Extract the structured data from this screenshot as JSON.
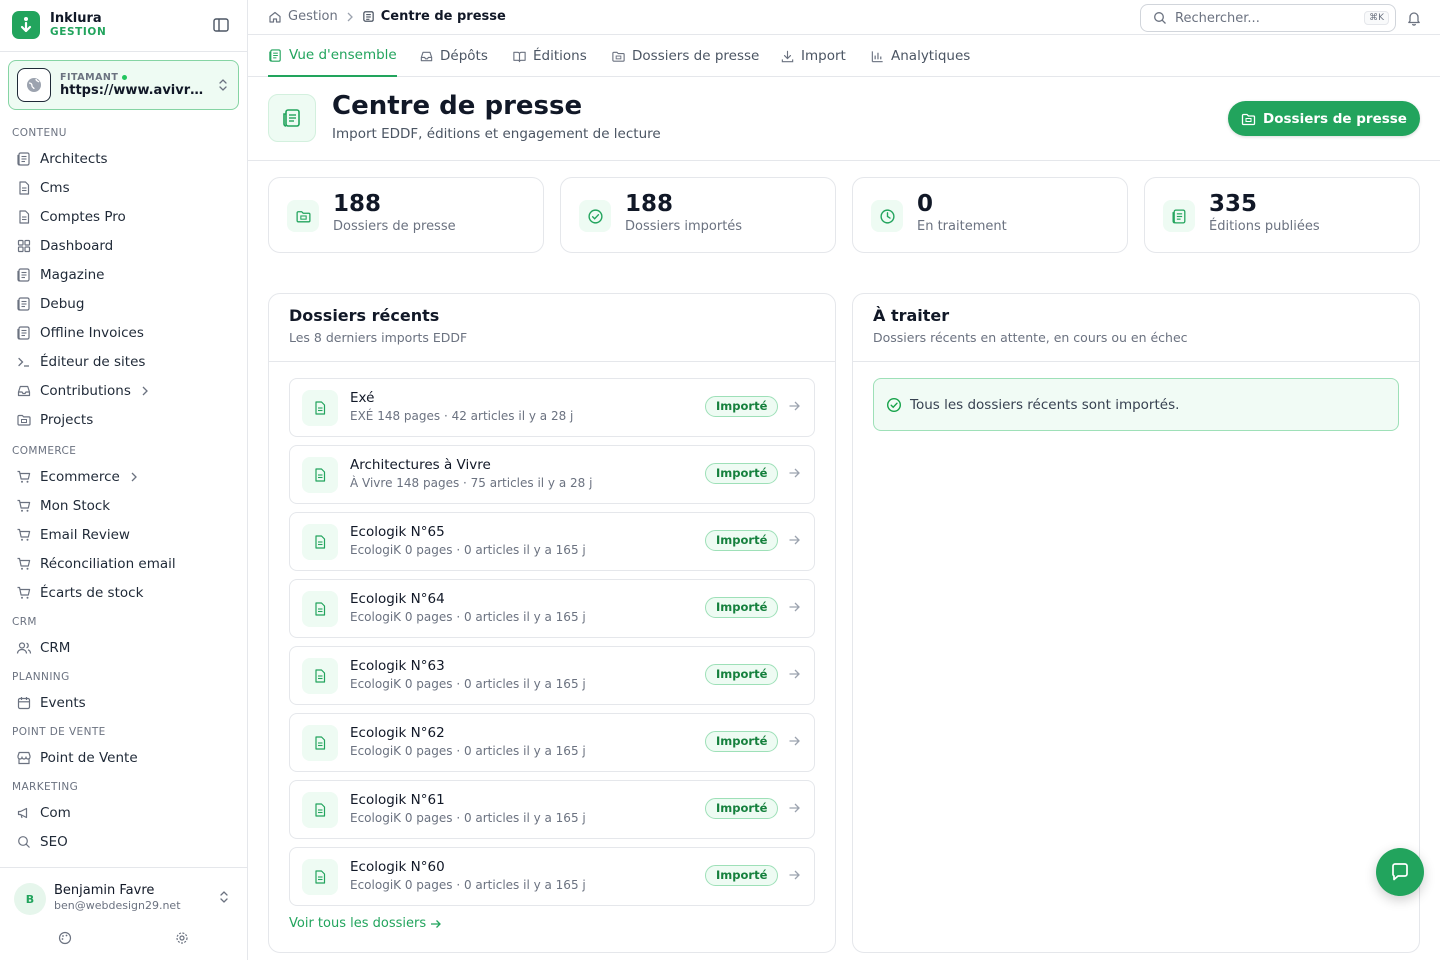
{
  "brand": {
    "name": "Inklura",
    "subtitle": "GESTION"
  },
  "site": {
    "label": "FITAMANT",
    "url": "https://www.avivre.fr"
  },
  "nav": {
    "sections": [
      {
        "title": "CONTENU",
        "items": [
          {
            "label": "Architects",
            "icon": "newspaper-icon"
          },
          {
            "label": "Cms",
            "icon": "document-icon"
          },
          {
            "label": "Comptes Pro",
            "icon": "document-icon"
          },
          {
            "label": "Dashboard",
            "icon": "grid-icon"
          },
          {
            "label": "Magazine",
            "icon": "newspaper-icon"
          },
          {
            "label": "Debug",
            "icon": "newspaper-icon"
          },
          {
            "label": "Offline Invoices",
            "icon": "newspaper-icon"
          },
          {
            "label": "Éditeur de sites",
            "icon": "terminal-icon"
          },
          {
            "label": "Contributions",
            "icon": "inbox-icon",
            "arrow": true
          },
          {
            "label": "Projects",
            "icon": "folder-icon"
          }
        ]
      },
      {
        "title": "COMMERCE",
        "items": [
          {
            "label": "Ecommerce",
            "icon": "cart-icon",
            "arrow": true
          },
          {
            "label": "Mon Stock",
            "icon": "cart-icon"
          },
          {
            "label": "Email Review",
            "icon": "cart-icon"
          },
          {
            "label": "Réconciliation email",
            "icon": "cart-icon"
          },
          {
            "label": "Écarts de stock",
            "icon": "cart-icon"
          }
        ]
      },
      {
        "title": "CRM",
        "items": [
          {
            "label": "CRM",
            "icon": "users-icon"
          }
        ]
      },
      {
        "title": "PLANNING",
        "items": [
          {
            "label": "Events",
            "icon": "calendar-icon"
          }
        ]
      },
      {
        "title": "POINT DE VENTE",
        "items": [
          {
            "label": "Point de Vente",
            "icon": "store-icon"
          }
        ]
      },
      {
        "title": "MARKETING",
        "items": [
          {
            "label": "Com",
            "icon": "megaphone-icon"
          },
          {
            "label": "SEO",
            "icon": "search-icon"
          }
        ]
      }
    ]
  },
  "user": {
    "initial": "B",
    "name": "Benjamin Favre",
    "email": "ben@webdesign29.net"
  },
  "breadcrumb": {
    "root": "Gestion",
    "current": "Centre de presse"
  },
  "search": {
    "placeholder": "Rechercher...",
    "shortcut": "⌘K"
  },
  "tabs": [
    {
      "label": "Vue d'ensemble",
      "icon": "newspaper-icon",
      "active": true
    },
    {
      "label": "Dépôts",
      "icon": "inbox-icon"
    },
    {
      "label": "Éditions",
      "icon": "book-icon"
    },
    {
      "label": "Dossiers de presse",
      "icon": "folder-icon"
    },
    {
      "label": "Import",
      "icon": "download-icon"
    },
    {
      "label": "Analytiques",
      "icon": "bar-chart-icon"
    }
  ],
  "header": {
    "title": "Centre de presse",
    "subtitle": "Import EDDF, éditions et engagement de lecture",
    "button_label": "Dossiers de presse"
  },
  "stats": [
    {
      "value": "188",
      "label": "Dossiers de presse",
      "icon": "folder-icon"
    },
    {
      "value": "188",
      "label": "Dossiers importés",
      "icon": "check-circle-icon"
    },
    {
      "value": "0",
      "label": "En traitement",
      "icon": "clock-icon"
    },
    {
      "value": "335",
      "label": "Éditions publiées",
      "icon": "newspaper-icon"
    }
  ],
  "recent": {
    "title": "Dossiers récents",
    "subtitle": "Les 8 derniers imports EDDF",
    "see_all": "Voir tous les dossiers",
    "rows": [
      {
        "title": "Exé",
        "meta": "EXÉ  148 pages · 42 articles   il y a 28 j",
        "status": "Importé"
      },
      {
        "title": "Architectures à Vivre",
        "meta": "À Vivre  148 pages · 75 articles   il y a 28 j",
        "status": "Importé"
      },
      {
        "title": "Ecologik N°65",
        "meta": "EcologiK  0 pages · 0 articles   il y a 165 j",
        "status": "Importé"
      },
      {
        "title": "Ecologik N°64",
        "meta": "EcologiK  0 pages · 0 articles   il y a 165 j",
        "status": "Importé"
      },
      {
        "title": "Ecologik N°63",
        "meta": "EcologiK  0 pages · 0 articles   il y a 165 j",
        "status": "Importé"
      },
      {
        "title": "Ecologik N°62",
        "meta": "EcologiK  0 pages · 0 articles   il y a 165 j",
        "status": "Importé"
      },
      {
        "title": "Ecologik N°61",
        "meta": "EcologiK  0 pages · 0 articles   il y a 165 j",
        "status": "Importé"
      },
      {
        "title": "Ecologik N°60",
        "meta": "EcologiK  0 pages · 0 articles   il y a 165 j",
        "status": "Importé"
      }
    ]
  },
  "todo": {
    "title": "À traiter",
    "subtitle": "Dossiers récents en attente, en cours ou en échec",
    "message": "Tous les dossiers récents sont importés."
  },
  "colors": {
    "accent": "#22a45d",
    "accent_light": "#eefbf3",
    "border": "#e5e7eb"
  }
}
